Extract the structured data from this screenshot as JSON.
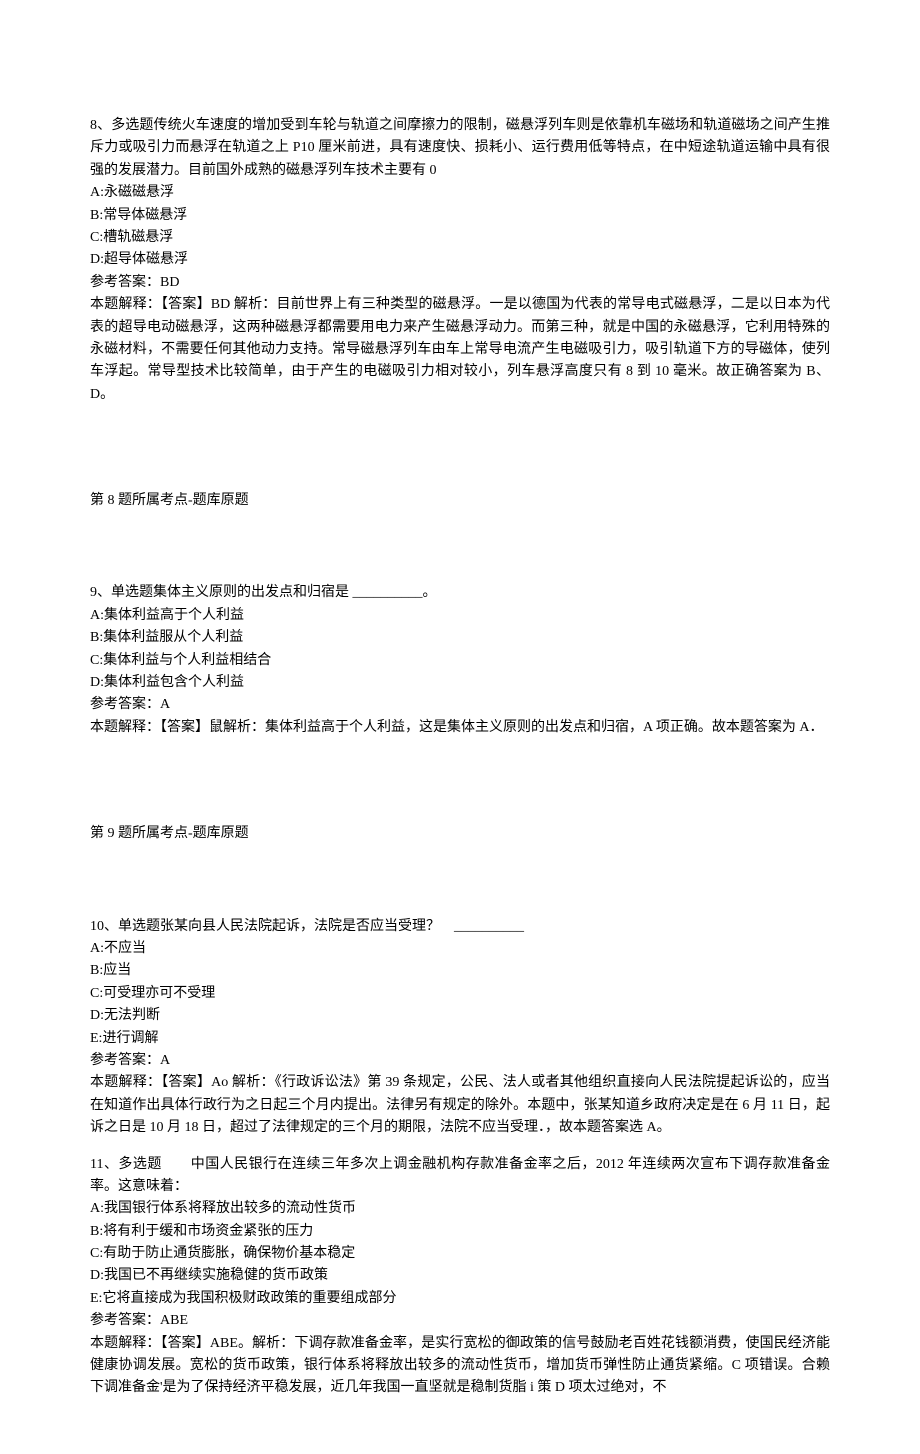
{
  "q8": {
    "stem": "8、多选题传统火车速度的增加受到车轮与轨道之间摩擦力的限制，磁悬浮列车则是依靠机车磁场和轨道磁场之间产生推斥力或吸引力而悬浮在轨道之上 P10 厘米前进，具有速度快、损耗小、运行费用低等特点，在中短途轨道运输中具有很强的发展潜力。目前国外成熟的磁悬浮列车技术主要有 0",
    "optA": "A:永磁磁悬浮",
    "optB": "B:常导体磁悬浮",
    "optC": "C:槽轨磁悬浮",
    "optD": "D:超导体磁悬浮",
    "ansLabel": "参考答案：BD",
    "explain": "本题解释：【答案】BD 解析：目前世界上有三种类型的磁悬浮。一是以德国为代表的常导电式磁悬浮，二是以日本为代表的超导电动磁悬浮，这两种磁悬浮都需要用电力来产生磁悬浮动力。而第三种，就是中国的永磁悬浮，它利用特殊的永磁材料，不需要任何其他动力支持。常导磁悬浮列车由车上常导电流产生电磁吸引力，吸引轨道下方的导磁体，使列车浮起。常导型技术比较简单，由于产生的电磁吸引力相对较小，列车悬浮高度只有 8 到 10 毫米。故正确答案为 B、D。",
    "topic": "第 8 题所属考点-题库原题"
  },
  "q9": {
    "stem": "9、单选题集体主义原则的出发点和归宿是 __________。",
    "optA": "A:集体利益高于个人利益",
    "optB": "B:集体利益服从个人利益",
    "optC": "C:集体利益与个人利益相结合",
    "optD": "D:集体利益包含个人利益",
    "ansLabel": "参考答案：A",
    "explain": "本题解释：【答案】鼠解析：集体利益高于个人利益，这是集体主义原则的出发点和归宿，A 项正确。故本题答案为 A．",
    "topic": "第 9 题所属考点-题库原题"
  },
  "q10": {
    "stem": "10、单选题张某向县人民法院起诉，法院是否应当受理？　__________",
    "optA": "A:不应当",
    "optB": "B:应当",
    "optC": "C:可受理亦可不受理",
    "optD": "D:无法判断",
    "optE": "E:进行调解",
    "ansLabel": "参考答案：A",
    "explain": "本题解释：【答案】Ao 解析：《行政诉讼法》第 39 条规定，公民、法人或者其他组织直接向人民法院提起诉讼的，应当在知道作出具体行政行为之日起三个月内提出。法律另有规定的除外。本题中，张某知道乡政府决定是在 6 月 11 日，起诉之日是 10 月 18 日，超过了法律规定的三个月的期限，法院不应当受理．，故本题答案选 A。"
  },
  "q11": {
    "stem": "11、多选题　　中国人民银行在连续三年多次上调金融机构存款准备金率之后，2012 年连续两次宣布下调存款准备金率。这意味着：",
    "optA": "A:我国银行体系将释放出较多的流动性货币",
    "optB": "B:将有利于缓和市场资金紧张的压力",
    "optC": "C:有助于防止通货膨胀，确保物价基本稳定",
    "optD": "D:我国已不再继续实施稳健的货币政策",
    "optE": "E:它将直接成为我国积极财政政策的重要组成部分",
    "ansLabel": "参考答案：ABE",
    "explain": "本题解释：【答案】ABE。解析：下调存款准备金率，是实行宽松的御政策的信号鼓励老百姓花钱额消费，使国民经济能健康协调发展。宽松的货币政策，银行体系将释放出较多的流动性货币，增加货币弹性防止通货紧缩。C 项错误。合赖下调准备金'是为了保持经济平稳发展，近几年我国一直坚就是稳制货脂 i 策 D 项太过绝对，不"
  }
}
